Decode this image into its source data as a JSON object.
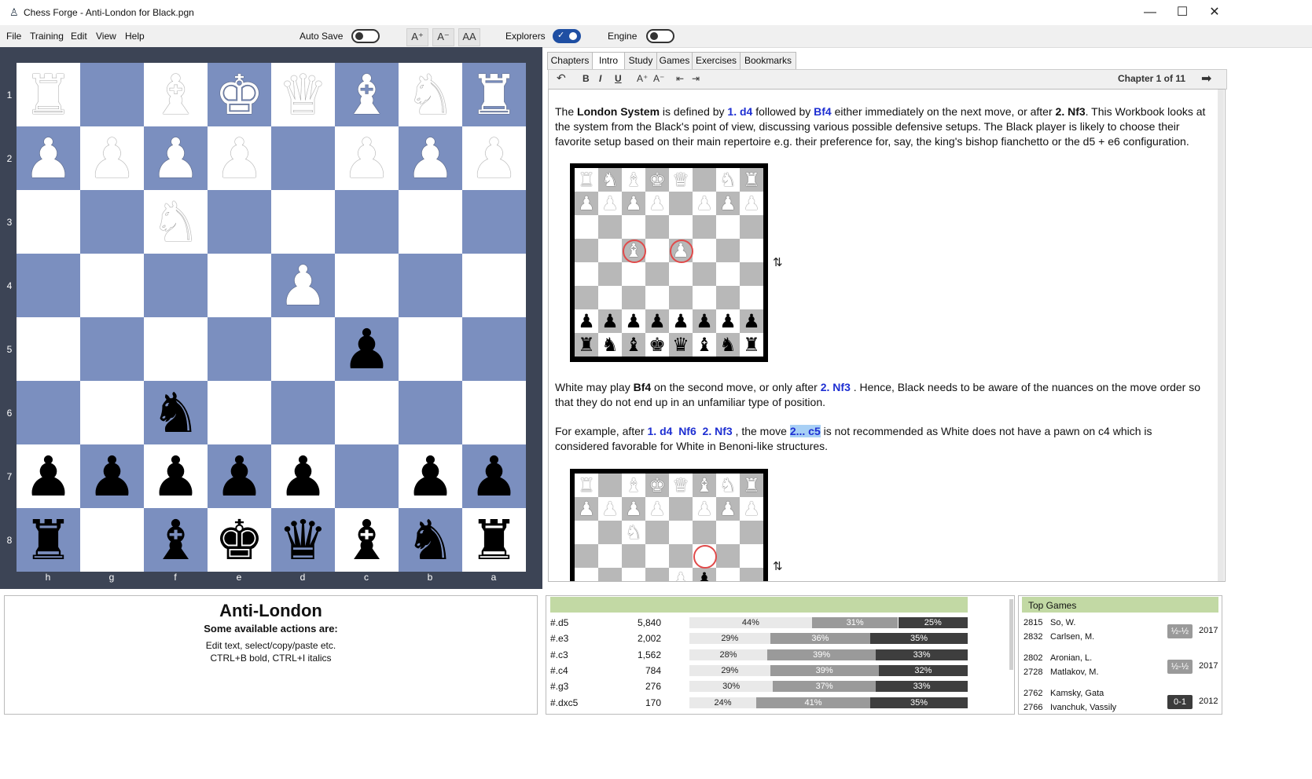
{
  "window": {
    "title": "Chess Forge - Anti-London for Black.pgn",
    "minimize": "—",
    "maximize": "☐",
    "close": "✕"
  },
  "menu": {
    "items": [
      "File",
      "Training",
      "Edit",
      "View",
      "Help"
    ],
    "auto_save_label": "Auto Save",
    "auto_save_on": false,
    "font_buttons": [
      "A⁺",
      "A⁻",
      "AA"
    ],
    "explorers_label": "Explorers",
    "explorers_on": true,
    "engine_label": "Engine",
    "engine_on": false
  },
  "board": {
    "light_color": "#ffffff",
    "dark_color": "#7b8fbf",
    "ranks": [
      "1",
      "2",
      "3",
      "4",
      "5",
      "6",
      "7",
      "8"
    ],
    "files": [
      "h",
      "g",
      "f",
      "e",
      "d",
      "c",
      "b",
      "a"
    ],
    "rows": [
      [
        {
          "p": "♜",
          "c": "w",
          "name": "rook"
        },
        {
          "p": "",
          "c": "",
          "name": ""
        },
        {
          "p": "♝",
          "c": "w",
          "name": "bishop"
        },
        {
          "p": "♚",
          "c": "w",
          "name": "king"
        },
        {
          "p": "♛",
          "c": "w",
          "name": "queen"
        },
        {
          "p": "♝",
          "c": "w",
          "name": "bishop"
        },
        {
          "p": "♞",
          "c": "w",
          "name": "knight"
        },
        {
          "p": "♜",
          "c": "w",
          "name": "rook"
        }
      ],
      [
        {
          "p": "♟",
          "c": "w",
          "name": "pawn"
        },
        {
          "p": "♟",
          "c": "w",
          "name": "pawn"
        },
        {
          "p": "♟",
          "c": "w",
          "name": "pawn"
        },
        {
          "p": "♟",
          "c": "w",
          "name": "pawn"
        },
        {
          "p": "",
          "c": "",
          "name": ""
        },
        {
          "p": "♟",
          "c": "w",
          "name": "pawn"
        },
        {
          "p": "♟",
          "c": "w",
          "name": "pawn"
        },
        {
          "p": "♟",
          "c": "w",
          "name": "pawn"
        }
      ],
      [
        {
          "p": "",
          "c": "",
          "name": ""
        },
        {
          "p": "",
          "c": "",
          "name": ""
        },
        {
          "p": "♞",
          "c": "w",
          "name": "knight"
        },
        {
          "p": "",
          "c": "",
          "name": ""
        },
        {
          "p": "",
          "c": "",
          "name": ""
        },
        {
          "p": "",
          "c": "",
          "name": ""
        },
        {
          "p": "",
          "c": "",
          "name": ""
        },
        {
          "p": "",
          "c": "",
          "name": ""
        }
      ],
      [
        {
          "p": "",
          "c": "",
          "name": ""
        },
        {
          "p": "",
          "c": "",
          "name": ""
        },
        {
          "p": "",
          "c": "",
          "name": ""
        },
        {
          "p": "",
          "c": "",
          "name": ""
        },
        {
          "p": "♟",
          "c": "w",
          "name": "pawn"
        },
        {
          "p": "",
          "c": "",
          "name": ""
        },
        {
          "p": "",
          "c": "",
          "name": ""
        },
        {
          "p": "",
          "c": "",
          "name": ""
        }
      ],
      [
        {
          "p": "",
          "c": "",
          "name": ""
        },
        {
          "p": "",
          "c": "",
          "name": ""
        },
        {
          "p": "",
          "c": "",
          "name": ""
        },
        {
          "p": "",
          "c": "",
          "name": ""
        },
        {
          "p": "",
          "c": "",
          "name": ""
        },
        {
          "p": "♟",
          "c": "b",
          "name": "pawn"
        },
        {
          "p": "",
          "c": "",
          "name": ""
        },
        {
          "p": "",
          "c": "",
          "name": ""
        }
      ],
      [
        {
          "p": "",
          "c": "",
          "name": ""
        },
        {
          "p": "",
          "c": "",
          "name": ""
        },
        {
          "p": "♞",
          "c": "b",
          "name": "knight"
        },
        {
          "p": "",
          "c": "",
          "name": ""
        },
        {
          "p": "",
          "c": "",
          "name": ""
        },
        {
          "p": "",
          "c": "",
          "name": ""
        },
        {
          "p": "",
          "c": "",
          "name": ""
        },
        {
          "p": "",
          "c": "",
          "name": ""
        }
      ],
      [
        {
          "p": "♟",
          "c": "b",
          "name": "pawn"
        },
        {
          "p": "♟",
          "c": "b",
          "name": "pawn"
        },
        {
          "p": "♟",
          "c": "b",
          "name": "pawn"
        },
        {
          "p": "♟",
          "c": "b",
          "name": "pawn"
        },
        {
          "p": "♟",
          "c": "b",
          "name": "pawn"
        },
        {
          "p": "",
          "c": "",
          "name": ""
        },
        {
          "p": "♟",
          "c": "b",
          "name": "pawn"
        },
        {
          "p": "♟",
          "c": "b",
          "name": "pawn"
        }
      ],
      [
        {
          "p": "♜",
          "c": "b",
          "name": "rook"
        },
        {
          "p": "",
          "c": "",
          "name": ""
        },
        {
          "p": "♝",
          "c": "b",
          "name": "bishop"
        },
        {
          "p": "♚",
          "c": "b",
          "name": "king"
        },
        {
          "p": "♛",
          "c": "b",
          "name": "queen"
        },
        {
          "p": "♝",
          "c": "b",
          "name": "bishop"
        },
        {
          "p": "♞",
          "c": "b",
          "name": "knight"
        },
        {
          "p": "♜",
          "c": "b",
          "name": "rook"
        }
      ]
    ]
  },
  "tabs": [
    "Chapters",
    "Intro",
    "Study",
    "Games",
    "Exercises",
    "Bookmarks"
  ],
  "active_tab": "Intro",
  "editor_toolbar": {
    "undo": "↶",
    "bold": "B",
    "italic": "I",
    "underline": "U",
    "font_up": "A⁺",
    "font_down": "A⁻",
    "indent": "⇤",
    "outdent": "⇥",
    "chapter_label": "Chapter 1 of 11",
    "next_arrow": "➡"
  },
  "intro": {
    "p1": {
      "t1": "The ",
      "b1": "London System",
      "t2": " is defined by ",
      "m1": "1. d4",
      "t3": " followed by ",
      "m2": "Bf4",
      "t4": " either immediately on the next move, or after ",
      "b2": "2. Nf3",
      "t5": ".  This Workbook looks at the system from the Black's point of view, discussing various possible defensive setups. The Black player is likely to choose their favorite setup based on their main repertoire e.g. their preference for, say, the king's bishop fianchetto or the d5 + e6 configuration."
    },
    "p2": {
      "t1": "White may play ",
      "b1": "Bf4",
      "t2": " on the second move, or only after ",
      "m1": "2. Nf3",
      "t3": " . Hence, Black needs to be aware of the nuances on the move order so that they do not end up in an unfamiliar type of position."
    },
    "p3": {
      "t1": "For example, after  ",
      "m1": "1. d4",
      "m2": "Nf6",
      "m3": "2. Nf3",
      "t2": " , the move ",
      "m4": "2... c5",
      "t3": " is not recommended as White does not have a pawn on c4 which is considered favorable for White in Benoni-like structures."
    },
    "diagram1": [
      "♜♞♝♚♛.♞♜",
      "♟♟♟♟.♟♟♟",
      "........",
      "..♝.♟...",
      "........",
      "........",
      "♟♟♟♟♟♟♟♟",
      "♜♞♝♚♛♝♞♜"
    ],
    "diagram1_colors": [
      "wwwww.ww",
      "wwww.www",
      "........",
      "..w.w...",
      "........",
      "........",
      "bbbbbbbb",
      "bbbbbbbb"
    ],
    "diagram2": [
      "♜.♝♚♛♝♞♜",
      "♟♟♟♟.♟♟♟",
      "..♞.....",
      "........",
      "....♟♟.."
    ],
    "diagram2_colors": [
      "w.wwwwww",
      "wwww.www",
      "..w.....",
      "........",
      "....wb.."
    ],
    "flip_icon": "⇅"
  },
  "comment_box": {
    "title": "Anti-London",
    "subtitle": "Some available actions are:",
    "line1": "Edit text, select/copy/paste etc.",
    "line2": "CTRL+B bold, CTRL+I italics"
  },
  "explorer": {
    "header_color": "#c2d9a4",
    "rows": [
      {
        "move": "#.d5",
        "count": "5,840",
        "w": 44,
        "d": 31,
        "b": 25
      },
      {
        "move": "#.e3",
        "count": "2,002",
        "w": 29,
        "d": 36,
        "b": 35
      },
      {
        "move": "#.c3",
        "count": "1,562",
        "w": 28,
        "d": 39,
        "b": 33
      },
      {
        "move": "#.c4",
        "count": "784",
        "w": 29,
        "d": 39,
        "b": 32
      },
      {
        "move": "#.g3",
        "count": "276",
        "w": 30,
        "d": 37,
        "b": 33
      },
      {
        "move": "#.dxc5",
        "count": "170",
        "w": 24,
        "d": 41,
        "b": 35
      }
    ]
  },
  "top_games": {
    "title": "Top Games",
    "games": [
      {
        "w_elo": "2815",
        "white": "So, W.",
        "b_elo": "2832",
        "black": "Carlsen, M.",
        "result": "½-½",
        "year": "2017"
      },
      {
        "w_elo": "2802",
        "white": "Aronian, L.",
        "b_elo": "2728",
        "black": "Matlakov, M.",
        "result": "½-½",
        "year": "2017"
      },
      {
        "w_elo": "2762",
        "white": "Kamsky, Gata",
        "b_elo": "2766",
        "black": "Ivanchuk, Vassily",
        "result": "0-1",
        "year": "2012"
      }
    ]
  }
}
